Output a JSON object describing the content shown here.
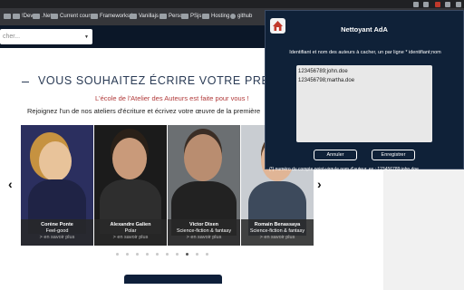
{
  "browser": {
    "bookmarks": [
      {
        "label": "",
        "icon": "folder-icon"
      },
      {
        "label": "!Dev",
        "icon": "folder-icon"
      },
      {
        "label": ".Net",
        "icon": "folder-icon"
      },
      {
        "label": "Current course",
        "icon": "folder-icon"
      },
      {
        "label": "Frameworks js",
        "icon": "folder-icon"
      },
      {
        "label": "Vanillajs",
        "icon": "folder-icon"
      },
      {
        "label": "Perso",
        "icon": "folder-icon"
      },
      {
        "label": "PSjs",
        "icon": "folder-icon"
      },
      {
        "label": "Hosting",
        "icon": "folder-icon"
      },
      {
        "label": "github",
        "icon": "github-icon"
      }
    ]
  },
  "site": {
    "search_placeholder": "cher..."
  },
  "hero": {
    "headline": "VOUS SOUHAITEZ ÉCRIRE VOTRE PREMIER R",
    "sub1": "L'école de l'Atelier des Auteurs est faite pour vous !",
    "sub2": "Rejoignez l'un de nos ateliers d'écriture et écrivez votre œuvre de la première"
  },
  "cards": [
    {
      "name": "Corène Ponte",
      "genre": "Feel-good",
      "more": "> en savoir plus"
    },
    {
      "name": "Alexandre Galien",
      "genre": "Polar",
      "more": "> en savoir plus"
    },
    {
      "name": "Victor Dixen",
      "genre": "Science-fiction & fantasy",
      "more": "> en savoir plus"
    },
    {
      "name": "Romain Benassaya",
      "genre": "Science-fiction & fantasy",
      "more": "> en savoir plus"
    }
  ],
  "carousel": {
    "total": 10,
    "active_index": 7
  },
  "popup": {
    "title": "Nettoyant AdA",
    "description": "Identifiant et nom des auteurs à cacher, un par ligne * identifiant;nom",
    "textarea_value": "123456789;john.doe\n123456798;martha.doe",
    "cancel_label": "Annuler",
    "save_label": "Enregistrer",
    "footnote": "(*) numéro du compte point-virgule nom d'auteur. ex : 123456789;john.doe"
  },
  "colors": {
    "popup_bg": "#0f2138",
    "headline": "#2a3b55",
    "subtitle_accent": "#b13a3a"
  }
}
